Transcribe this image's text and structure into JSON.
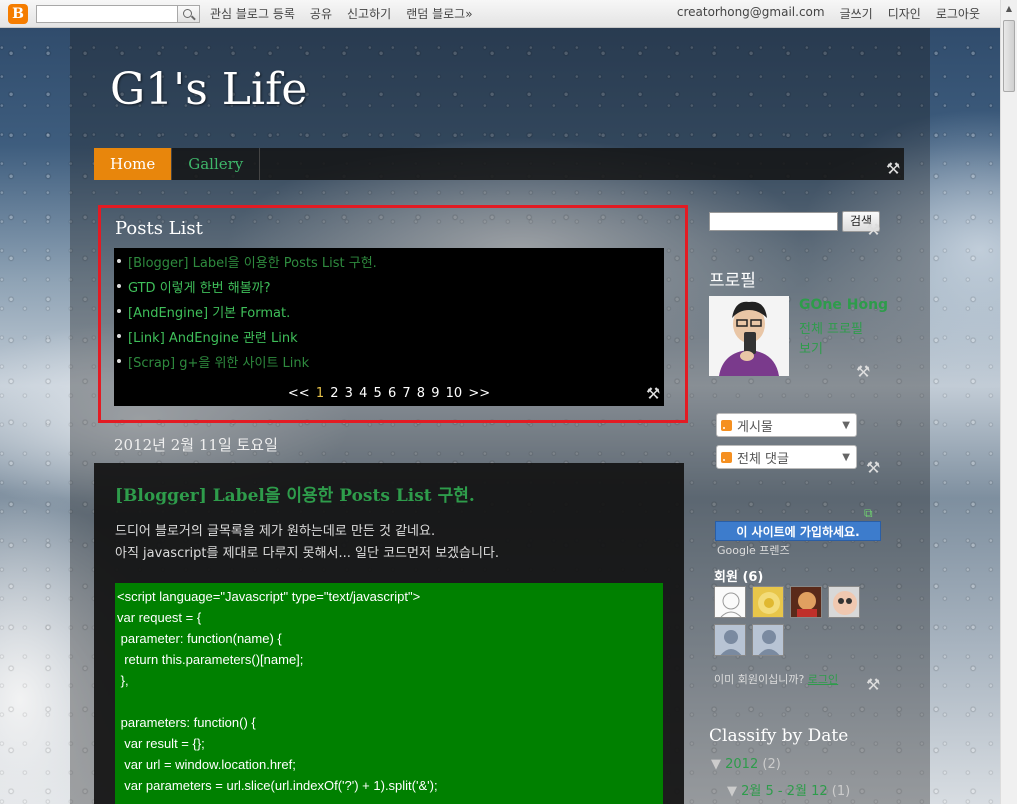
{
  "navbar": {
    "links": [
      "관심 블로그 등록",
      "공유",
      "신고하기",
      "랜덤 블로그»"
    ],
    "email": "creatorhong@gmail.com",
    "right_links": [
      "글쓰기",
      "디자인",
      "로그아웃"
    ]
  },
  "blog": {
    "title": "G1's Life"
  },
  "tabs": [
    {
      "label": "Home",
      "active": true
    },
    {
      "label": "Gallery",
      "active": false
    }
  ],
  "posts_list": {
    "title": "Posts List",
    "items": [
      "[Blogger] Label을 이용한 Posts List 구현.",
      "GTD 이렇게 한번 해볼까?",
      "[AndEngine] 기본 Format.",
      "[Link] AndEngine 관련 Link",
      "[Scrap] g+을 위한 사이트 Link"
    ],
    "pager": {
      "prev": "<<",
      "pages": [
        "1",
        "2",
        "3",
        "4",
        "5",
        "6",
        "7",
        "8",
        "9",
        "10"
      ],
      "current": "1",
      "next": ">>"
    }
  },
  "post": {
    "date": "2012년 2월 11일 토요일",
    "title": "[Blogger] Label을 이용한 Posts List 구현.",
    "body": [
      "드디어 블로거의 글목록을 제가 원하는데로 만든 것 같네요.",
      "아직 javascript를 제대로 다루지 못해서... 일단 코드먼저 보겠습니다."
    ],
    "code": [
      "<script language=\"Javascript\" type=\"text/javascript\">",
      "var request = {",
      " parameter: function(name) {",
      "  return this.parameters()[name];",
      " },",
      "",
      " parameters: function() {",
      "  var result = {};",
      "  var url = window.location.href;",
      "  var parameters = url.slice(url.indexOf('?') + 1).split('&');"
    ]
  },
  "sidebar": {
    "search_button": "검색",
    "profile_heading": "프로필",
    "profile_name": "GOne Hong",
    "profile_link": "전체 프로필 보기",
    "feeds": [
      "게시물",
      "전체 댓글"
    ],
    "join_button": "이 사이트에 가입하세요.",
    "google_friends": "Google 프렌즈",
    "members_title": "회원 (6)",
    "already_member": "이미 회원이십니까?",
    "login_link": "로그인",
    "archive_heading": "Classify by Date",
    "archive_year": "2012",
    "archive_year_count": "(2)",
    "archive_month": "2월 5 - 2월 12",
    "archive_month_count": "(1)"
  }
}
